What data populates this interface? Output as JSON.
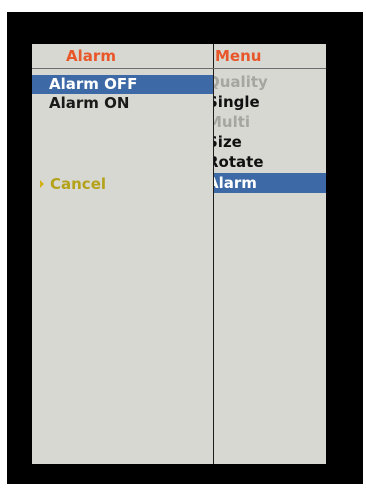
{
  "left_menu": {
    "title": "Alarm",
    "items": [
      {
        "label": "Alarm OFF",
        "state": "selected"
      },
      {
        "label": "Alarm ON",
        "state": "normal"
      }
    ],
    "cancel_label": "Cancel"
  },
  "right_menu": {
    "title": "Menu",
    "items": [
      {
        "label": "Quality",
        "state": "disabled"
      },
      {
        "label": "Single",
        "state": "normal"
      },
      {
        "label": "Multi",
        "state": "disabled"
      },
      {
        "label": "Size",
        "state": "normal"
      },
      {
        "label": "Rotate",
        "state": "normal"
      },
      {
        "label": "Alarm",
        "state": "selected"
      }
    ]
  },
  "colors": {
    "title": "#e8572a",
    "selection": "#3d6aa6",
    "panel": "#d8d8d2",
    "disabled_text": "#a6a6a0",
    "cancel": "#b3a21a"
  },
  "icons": {
    "cancel_marker": "triangle-right-icon"
  }
}
